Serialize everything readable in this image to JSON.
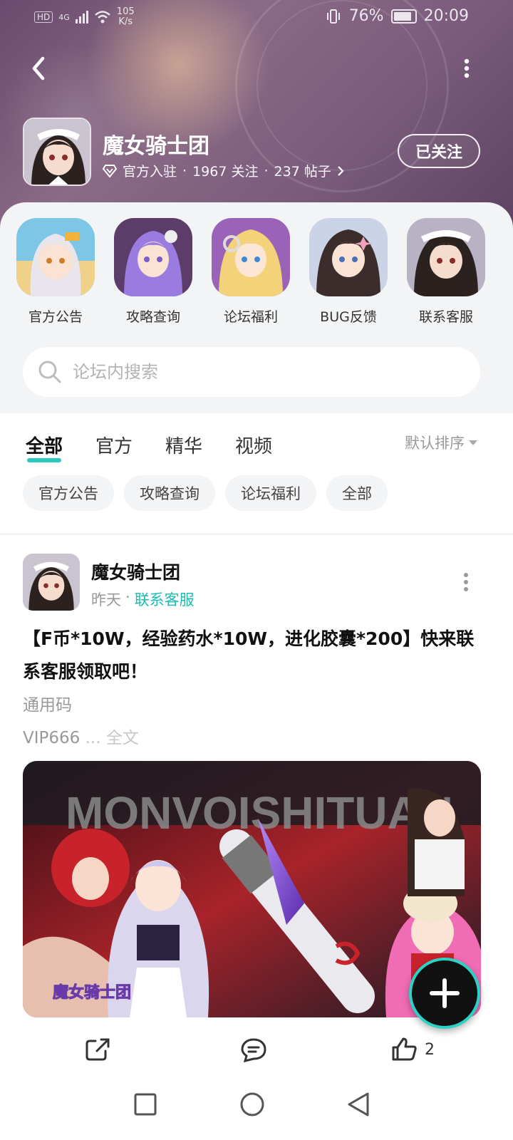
{
  "status_bar": {
    "network": "HD",
    "network_sub": "4G",
    "speed_value": "105",
    "speed_unit": "K/s",
    "battery": "76%",
    "time": "20:09"
  },
  "forum": {
    "name": "魔女骑士团",
    "verified_label": "官方入驻",
    "followers": "1967 关注",
    "posts": "237 帖子",
    "sep": "·",
    "follow_button": "已关注"
  },
  "shortcuts": [
    {
      "label": "官方公告",
      "icon": "white-hair-girl"
    },
    {
      "label": "攻略查询",
      "icon": "purple-hair-girl"
    },
    {
      "label": "论坛福利",
      "icon": "blonde-girl"
    },
    {
      "label": "BUG反馈",
      "icon": "dark-hair-girl"
    },
    {
      "label": "联系客服",
      "icon": "maid-girl"
    }
  ],
  "search": {
    "placeholder": "论坛内搜索"
  },
  "tabs": [
    {
      "label": "全部",
      "active": true
    },
    {
      "label": "官方",
      "active": false
    },
    {
      "label": "精华",
      "active": false
    },
    {
      "label": "视频",
      "active": false
    }
  ],
  "sort_label": "默认排序",
  "chips": [
    "官方公告",
    "攻略查询",
    "论坛福利",
    "全部"
  ],
  "post": {
    "author": "魔女骑士团",
    "time": "昨天",
    "sep": "·",
    "category": "联系客服",
    "title": "【F币*10W，经验药水*10W，进化胶囊*200】快来联系客服领取吧！",
    "line1": "通用码",
    "line2": "VIP666",
    "ellipsis": " ... ",
    "full_text": "全文",
    "image_banner": "MONVOISHITUAN",
    "image_logo": "魔女骑士团"
  },
  "actions": {
    "like_count": "2"
  },
  "colors": {
    "accent": "#1cbcb2",
    "header_bg": "#7b5c7d",
    "panel_bg": "#f3f4f6"
  }
}
